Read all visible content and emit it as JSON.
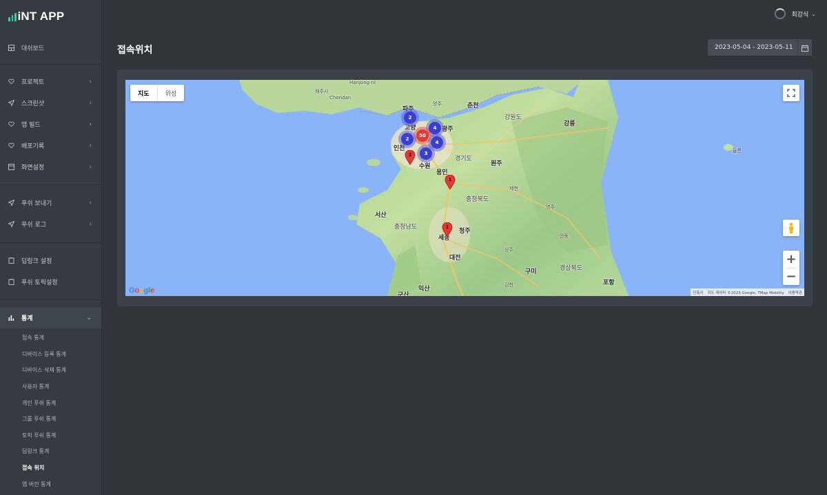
{
  "app": {
    "logo_text": "iNT APP"
  },
  "sidebar": {
    "groups": [
      {
        "items": [
          {
            "label": "대쉬보드",
            "icon": "dashboard-icon"
          }
        ]
      },
      {
        "items": [
          {
            "label": "프로젝트",
            "icon": "heart-icon"
          },
          {
            "label": "스크린샷",
            "icon": "send-icon"
          },
          {
            "label": "앱 빌드",
            "icon": "heart-icon"
          },
          {
            "label": "배포기록",
            "icon": "heart-icon"
          },
          {
            "label": "화면설정",
            "icon": "window-icon"
          }
        ]
      },
      {
        "items": [
          {
            "label": "푸쉬 보내기",
            "icon": "send-icon"
          },
          {
            "label": "푸쉬 로그",
            "icon": "send-icon"
          }
        ]
      },
      {
        "items": [
          {
            "label": "딥링크 설정",
            "icon": "clipboard-icon"
          },
          {
            "label": "푸쉬 토픽설정",
            "icon": "clipboard-icon"
          }
        ]
      }
    ],
    "stats": {
      "label": "통계",
      "icon": "bar-chart-icon",
      "sub_items": [
        "접속 통계",
        "디바이스 등록 통계",
        "디바이스 삭제 통계",
        "사용자 통계",
        "개인 푸쉬 통계",
        "그룹 푸쉬 통계",
        "토픽 푸쉬 통계",
        "딥링크 통계",
        "접속 위치",
        "앱 버전 통계"
      ],
      "current_index": 8
    }
  },
  "header": {
    "user_name": "최강식",
    "page_title": "접속위치",
    "date_range": "2023-05-04 - 2023-05-11"
  },
  "map": {
    "map_type_tabs": [
      "지도",
      "위성"
    ],
    "selected_tab": "지도",
    "google_logo": "Google",
    "attribution": [
      "단축키",
      "지도 데이터 ©2023 Google, TMap Mobility",
      "이용약관"
    ],
    "places": {
      "paju": "파주",
      "goyang": "고양",
      "incheon": "인천",
      "suwon": "수원",
      "yongin": "용인",
      "gyeonggi": "경기도",
      "wonju": "원주",
      "chuncheon": "춘천",
      "gangwon": "강원도",
      "gangneung": "강릉",
      "chungbuk": "충청북도",
      "chungnam": "충청남도",
      "seosan": "서산",
      "cheongju": "청주",
      "sejong": "세종",
      "daejeon": "대전",
      "gumi": "구미",
      "gyeongbuk": "경상북도",
      "pohang": "포항",
      "iksan": "익산",
      "gunsan": "군산",
      "hanjung": "Hanjong-ni",
      "haeju": "해주시",
      "chondan": "Chondan",
      "yangju": "양주",
      "ulleung": "울릉",
      "andong": "안동",
      "jecheon": "제천",
      "yeongju": "영주",
      "gwangju_g": "광주",
      "gimcheon": "김천",
      "sangju": "상주"
    },
    "clusters": [
      {
        "count": "2",
        "color": "blue"
      },
      {
        "count": "4",
        "color": "blue"
      },
      {
        "count": "50",
        "color": "red"
      },
      {
        "count": "2",
        "color": "blue"
      },
      {
        "count": "4",
        "color": "blue"
      },
      {
        "count": "3",
        "color": "blue"
      }
    ],
    "pins": [
      {
        "count": "2"
      },
      {
        "count": "1"
      },
      {
        "count": "1"
      }
    ]
  },
  "colors": {
    "accent": "#2ed3a3",
    "background": "#2f353b",
    "sidebar": "#343b42",
    "card": "#3a4148"
  }
}
